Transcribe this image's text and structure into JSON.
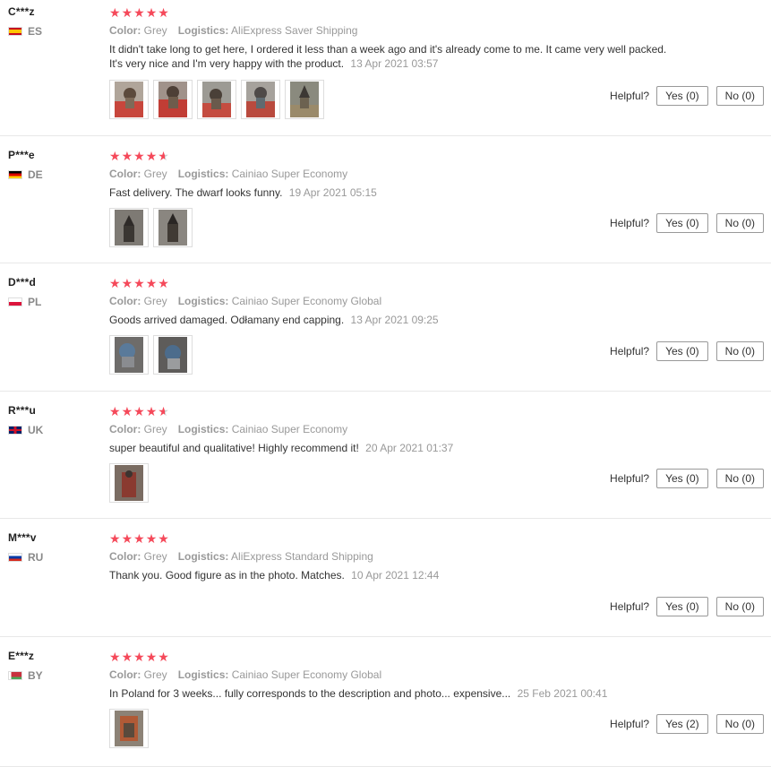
{
  "helpful_label": "Helpful?",
  "color_label": "Color:",
  "logistics_label": "Logistics:",
  "reviews": [
    {
      "user": "C***z",
      "country": "ES",
      "rating": 5,
      "color": "Grey",
      "logistics": "AliExpress Saver Shipping",
      "text": "It didn't take long to get here, I ordered it less than a week ago and it's already come to me. It came very well packed. It's very nice and I'm very happy with the product.",
      "date": "13 Apr 2021 03:57",
      "yes": "Yes (0)",
      "no": "No (0)",
      "photos": 5
    },
    {
      "user": "P***e",
      "country": "DE",
      "rating": 4.5,
      "color": "Grey",
      "logistics": "Cainiao Super Economy",
      "text": "Fast delivery. The dwarf looks funny.",
      "date": "19 Apr 2021 05:15",
      "yes": "Yes (0)",
      "no": "No (0)",
      "photos": 2
    },
    {
      "user": "D***d",
      "country": "PL",
      "rating": 5,
      "color": "Grey",
      "logistics": "Cainiao Super Economy Global",
      "text": "Goods arrived damaged. Odłamany end capping.",
      "date": "13 Apr 2021 09:25",
      "yes": "Yes (0)",
      "no": "No (0)",
      "photos": 2
    },
    {
      "user": "R***u",
      "country": "UK",
      "rating": 4.5,
      "color": "Grey",
      "logistics": "Cainiao Super Economy",
      "text": "super beautiful and qualitative! Highly recommend it!",
      "date": "20 Apr 2021 01:37",
      "yes": "Yes (0)",
      "no": "No (0)",
      "photos": 1
    },
    {
      "user": "M***v",
      "country": "RU",
      "rating": 5,
      "color": "Grey",
      "logistics": "AliExpress Standard Shipping",
      "text": "Thank you. Good figure as in the photo. Matches.",
      "date": "10 Apr 2021 12:44",
      "yes": "Yes (0)",
      "no": "No (0)",
      "photos": 0
    },
    {
      "user": "E***z",
      "country": "BY",
      "rating": 5,
      "color": "Grey",
      "logistics": "Cainiao Super Economy Global",
      "text": "In Poland for 3 weeks... fully corresponds to the description and photo... expensive...",
      "date": "25 Feb 2021 00:41",
      "yes": "Yes (2)",
      "no": "No (0)",
      "photos": 1
    }
  ],
  "colors": {
    "star": "#f5495a",
    "muted": "#999999",
    "border": "#e8e8e8"
  }
}
